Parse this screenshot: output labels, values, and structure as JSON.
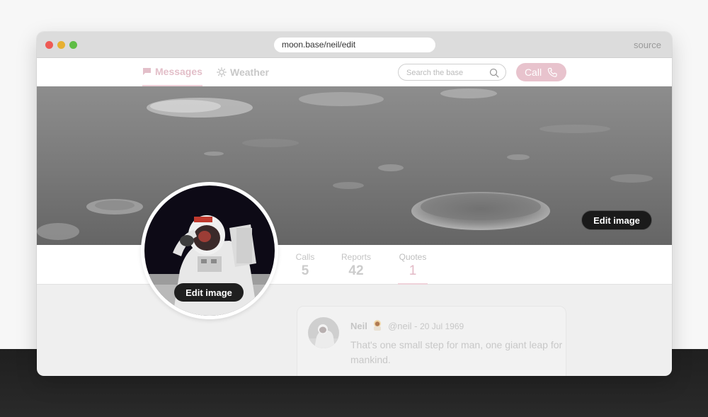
{
  "browser": {
    "url": "moon.base/neil/edit",
    "source_label": "source"
  },
  "nav": {
    "tabs": [
      {
        "label": "Messages",
        "icon": "chat-bubble-icon",
        "active": true
      },
      {
        "label": "Weather",
        "icon": "sun-icon",
        "active": false
      }
    ],
    "search_placeholder": "Search the base",
    "call_label": "Call"
  },
  "profile": {
    "cover_edit_label": "Edit image",
    "avatar_edit_label": "Edit image",
    "stats": [
      {
        "label": "Calls",
        "value": "5"
      },
      {
        "label": "Reports",
        "value": "42"
      },
      {
        "label": "Quotes",
        "value": "1",
        "active": true
      }
    ]
  },
  "post": {
    "name": "Neil",
    "emoji_icon": "astronaut-emoji-icon",
    "handle": "@neil",
    "separator": "-",
    "date": "20 Jul 1969",
    "text": "That's one small step for man, one giant leap for mankind."
  },
  "colors": {
    "accent": "#e8c3cd",
    "accent_text": "#e3bfc9",
    "background_dark": "#1f1f1f"
  }
}
